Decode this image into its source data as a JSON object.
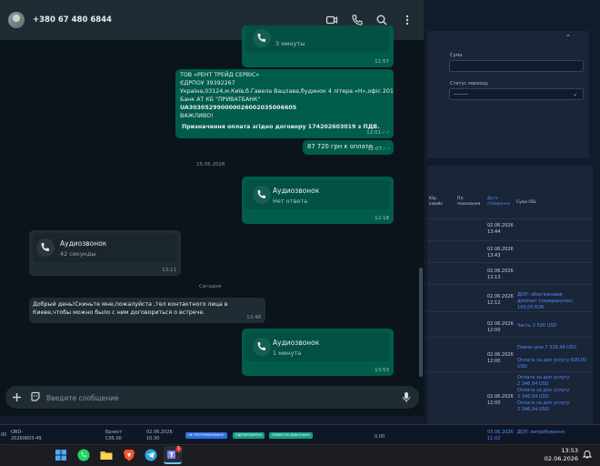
{
  "whatsapp": {
    "contact": "+380 67 480 6844",
    "input_placeholder": "Введите сообщение",
    "messages": {
      "call_top": {
        "subtitle": "3 минуты",
        "time": "11:57"
      },
      "details": {
        "lines": [
          "ТОВ «РЕНТ ТРЕЙД СЕРВІС»",
          "ЄДРПОУ 39392267",
          "Україна,03124,м.Київ,б.Гавела Вацлава,будинок 4 літера «Н»,офіс 201",
          "Банк АТ КБ \"ПРИВАТБАНК\"",
          "UA303052990000026002035006605",
          "ВАЖЛИВО!",
          "Призначення оплата згідно договору 174202603019 з ПДВ."
        ],
        "time": "12:01"
      },
      "amount": {
        "text": "87 720 грн к оплате",
        "time": "12:07"
      },
      "date1": "25.05.2026",
      "call_no_answer": {
        "title": "Аудиозвонок",
        "subtitle": "Нет ответа",
        "time": "12:18"
      },
      "call_in": {
        "title": "Аудиозвонок",
        "subtitle": "42 секунды",
        "time": "13:11"
      },
      "date2": "Сегодня",
      "incoming_text": {
        "line1": "Добрый день!Скиньте мне,пожалуйста ,тел контактного лица в",
        "line2": "Киеве,чтобы можно было с ним договориться о встрече.",
        "time": "13:48"
      },
      "call_last": {
        "title": "Аудиозвонок",
        "subtitle": "1 минута",
        "time": "13:53"
      }
    }
  },
  "crm": {
    "filter": {
      "sum_label": "Сума",
      "status_label": "Статус периоду",
      "status_value": "---------"
    },
    "columns": [
      "Юр. інвойс",
      "Пл. посилання",
      "Дата створення",
      "Сума USL"
    ],
    "rows": [
      {
        "date": "02.06.2026",
        "time": "13:44",
        "links": []
      },
      {
        "date": "02.06.2026",
        "time": "13:43",
        "links": []
      },
      {
        "date": "02.06.2026",
        "time": "13:13",
        "links": []
      },
      {
        "date": "02.06.2026",
        "time": "12:12",
        "links": [
          "ДОП: обов'язковий",
          "депозит (перерахунок)",
          "100,00 EUR"
        ]
      },
      {
        "date": "02.06.2026",
        "time": "12:00",
        "links": [
          "Часть 2 500 USD"
        ]
      },
      {
        "date": "02.06.2026",
        "time": "12:00",
        "links": [
          "Повна ціна 7 328,49 USD",
          "Оплата за доп услугу 600,00 USD"
        ]
      },
      {
        "date": "02.06.2026",
        "time": "12:00",
        "links": [
          "Оплата за доп услугу",
          "2 346,94 USD",
          "Оплата за доп услугу",
          "2 346,94 USD",
          "Оплата за доп услугу",
          "2 346,94 USD"
        ]
      },
      {
        "date": "03.06.2026",
        "time": "11:02",
        "links": [
          "ДОП: витребування"
        ]
      }
    ],
    "bottom_row": {
      "id1": "ORD-",
      "id2": "20260603-49",
      "c2": "Ернест",
      "c3": "С05,00",
      "date": "02.06.2026",
      "time": "10:30",
      "badges": [
        "НЕ ПРОТЕРМІНОВАНО",
        "ПІДТВЕРДЖЕНО",
        "ПОВНІСТЮ ВИКОНАНО"
      ],
      "value": "0,00"
    }
  },
  "taskbar": {
    "time": "13:53",
    "date": "02.06.2026",
    "notif_count": "1"
  },
  "colors": {
    "wa_outgoing": "#005c4b",
    "wa_incoming": "#202c33",
    "crm_link": "#4f8cff"
  }
}
